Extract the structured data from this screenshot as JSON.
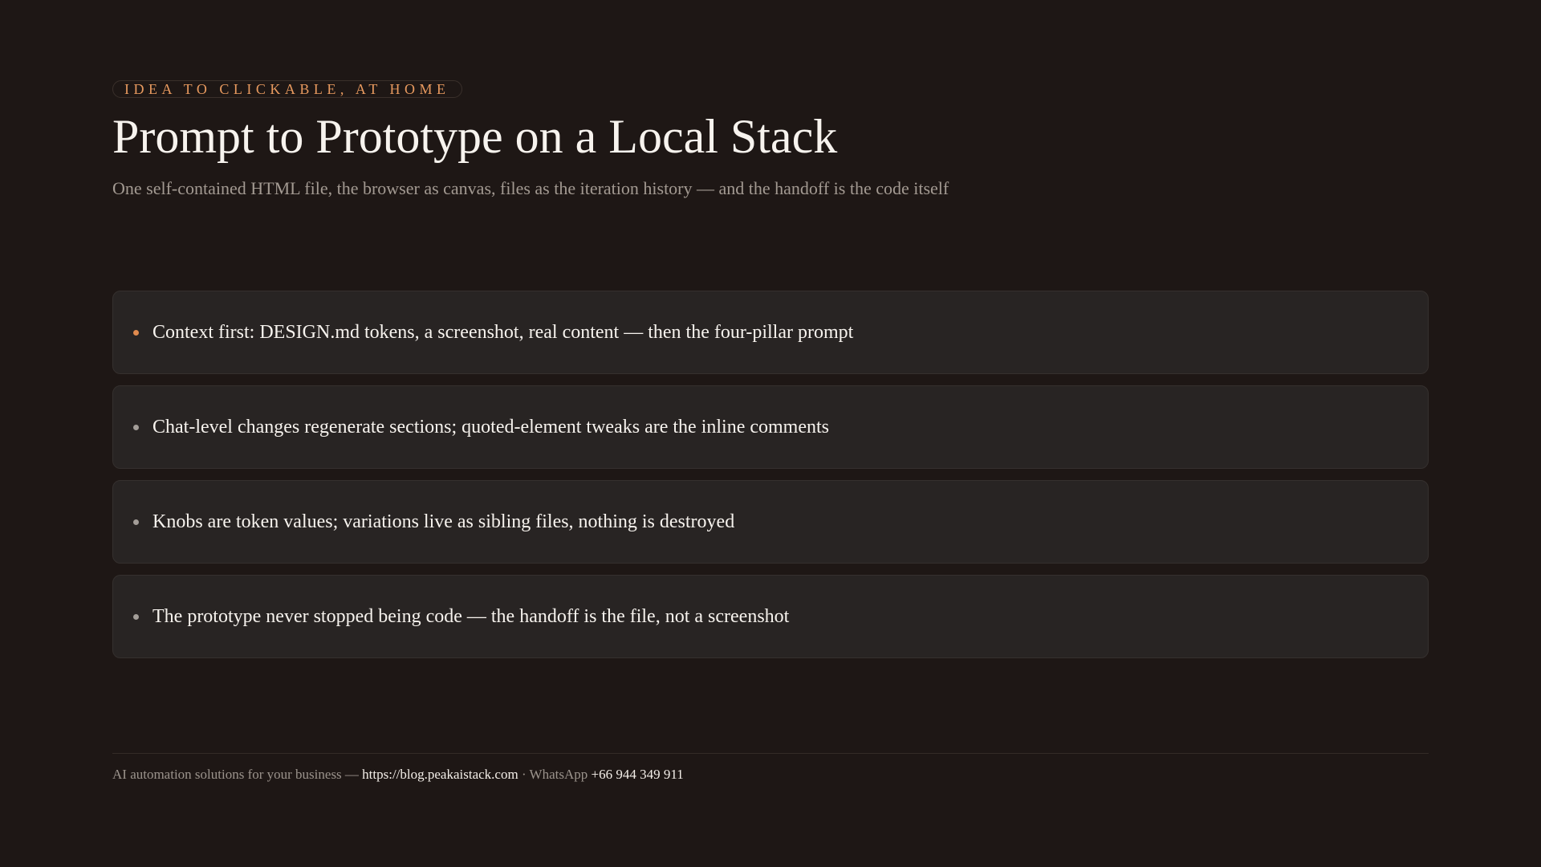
{
  "header": {
    "eyebrow": "IDEA TO CLICKABLE, AT HOME",
    "title": "Prompt to Prototype on a Local Stack",
    "subtitle": "One self-contained HTML file, the browser as canvas, files as the iteration history — and the handoff is the code itself"
  },
  "bullets": [
    {
      "text": "Context first: DESIGN.md tokens, a screenshot, real content — then the four-pillar prompt"
    },
    {
      "text": "Chat-level changes regenerate sections; quoted-element tweaks are the inline comments"
    },
    {
      "text": "Knobs are token values; variations live as sibling files, nothing is destroyed"
    },
    {
      "text": "The prototype never stopped being code — the handoff is the file, not a screenshot"
    }
  ],
  "footer": {
    "tagline": "AI automation solutions for your business —",
    "url": "https://blog.peakaistack.com",
    "separator": "· WhatsApp",
    "phone": "+66 944 349 911"
  },
  "colors": {
    "background": "#1e1715",
    "accent": "#e08a4e",
    "card": "#282423"
  }
}
